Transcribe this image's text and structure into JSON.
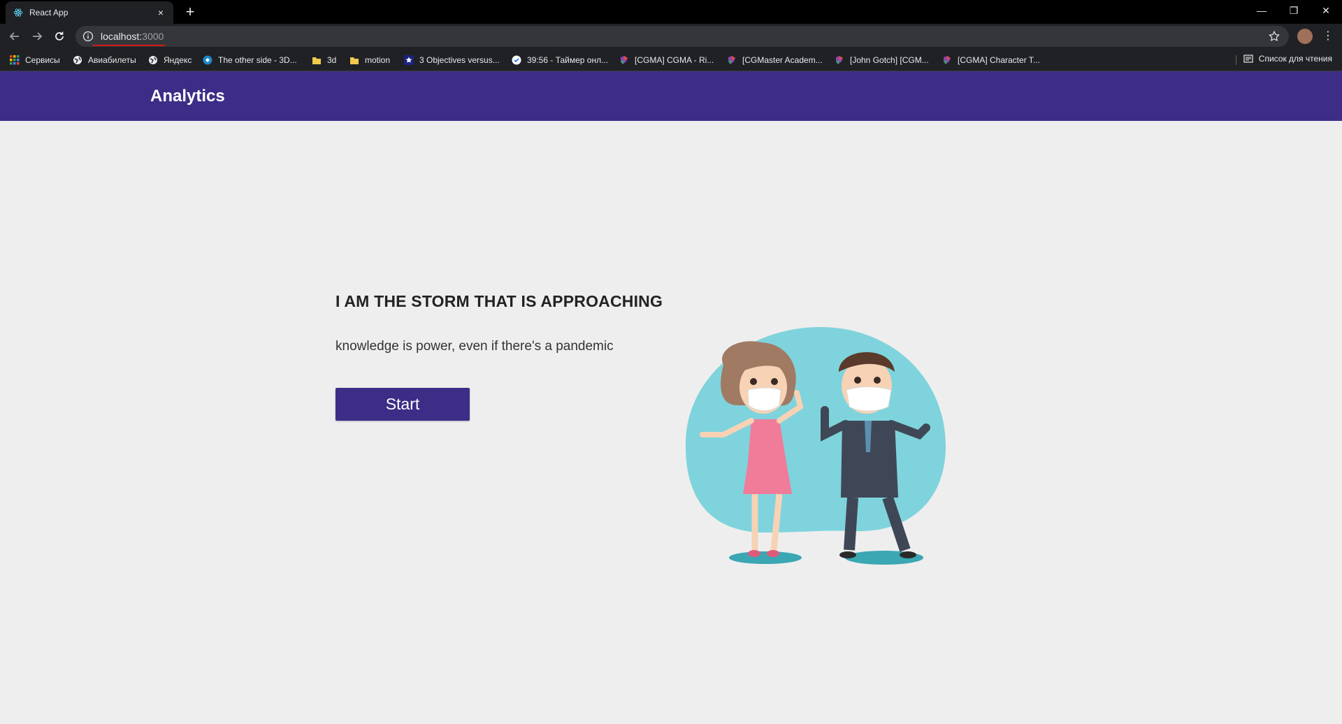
{
  "browser": {
    "tab_title": "React App",
    "tab_close": "×",
    "new_tab": "+",
    "url_host": "localhost:",
    "url_port": "3000",
    "menu": "⋮",
    "window": {
      "minimize": "—",
      "restore": "❐",
      "close": "✕"
    }
  },
  "bookmarks": [
    {
      "label": "Сервисы",
      "icon": "apps-grid-icon"
    },
    {
      "label": "Авиабилеты",
      "icon": "globe-icon"
    },
    {
      "label": "Яндекс",
      "icon": "globe-icon"
    },
    {
      "label": "The other side - 3D...",
      "icon": "site-icon"
    },
    {
      "label": "3d",
      "icon": "folder-icon"
    },
    {
      "label": "motion",
      "icon": "folder-icon"
    },
    {
      "label": "3 Objectives versus...",
      "icon": "star-site-icon"
    },
    {
      "label": "39:56 - Таймер онл...",
      "icon": "timer-icon"
    },
    {
      "label": "[CGMA] CGMA - Ri...",
      "icon": "cgma-icon"
    },
    {
      "label": "[CGMaster Academ...",
      "icon": "cgma-icon"
    },
    {
      "label": "[John Gotch] [CGM...",
      "icon": "cgma-icon"
    },
    {
      "label": "[CGMA] Character T...",
      "icon": "cgma-icon"
    }
  ],
  "reading_list": "Список для чтения",
  "app": {
    "brand": "Analytics",
    "hero_title": "I AM THE STORM THAT IS APPROACHING",
    "hero_subtitle": "knowledge is power, even if there's a pandemic",
    "start_label": "Start"
  },
  "colors": {
    "brand": "#3d2d87",
    "background": "#eeeeee",
    "illustration_blob": "#7fd3dc"
  }
}
